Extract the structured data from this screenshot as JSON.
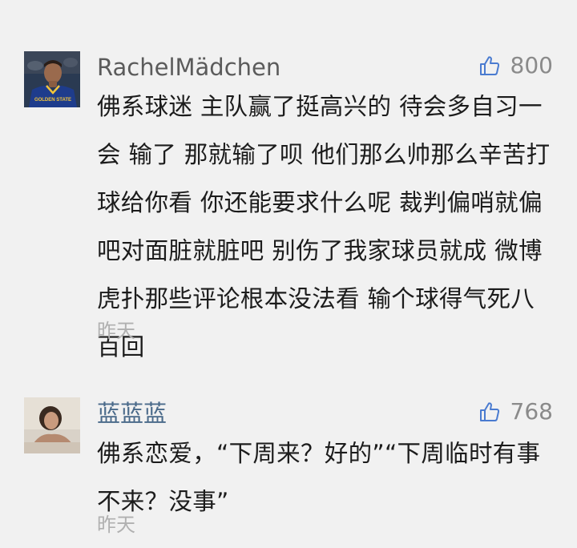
{
  "comments": [
    {
      "username": "RachelMädchen",
      "likes": "800",
      "text": "佛系球迷 主队赢了挺高兴的 待会多自习一会 输了 那就输了呗 他们那么帅那么辛苦打球给你看 你还能要求什么呢 裁判偏哨就偏吧对面脏就脏吧 别伤了我家球员就成 微博虎扑那些评论根本没法看 输个球得气死八百回",
      "time": "昨天",
      "avatar_jersey_text": "GOLDEN STATE",
      "icon": "thumbs-up-icon"
    },
    {
      "username": "蓝蓝蓝",
      "likes": "768",
      "text": "佛系恋爱，“下周来？好的”“下周临时有事不来？没事”",
      "time": "昨天",
      "icon": "thumbs-up-icon"
    }
  ],
  "colors": {
    "background": "#f1f1f1",
    "username_1": "#5b5b5b",
    "username_2": "#4a6a8a",
    "like_icon": "#4a7bd0",
    "body_text": "#1c1c1c",
    "time": "#b0b0b0"
  }
}
